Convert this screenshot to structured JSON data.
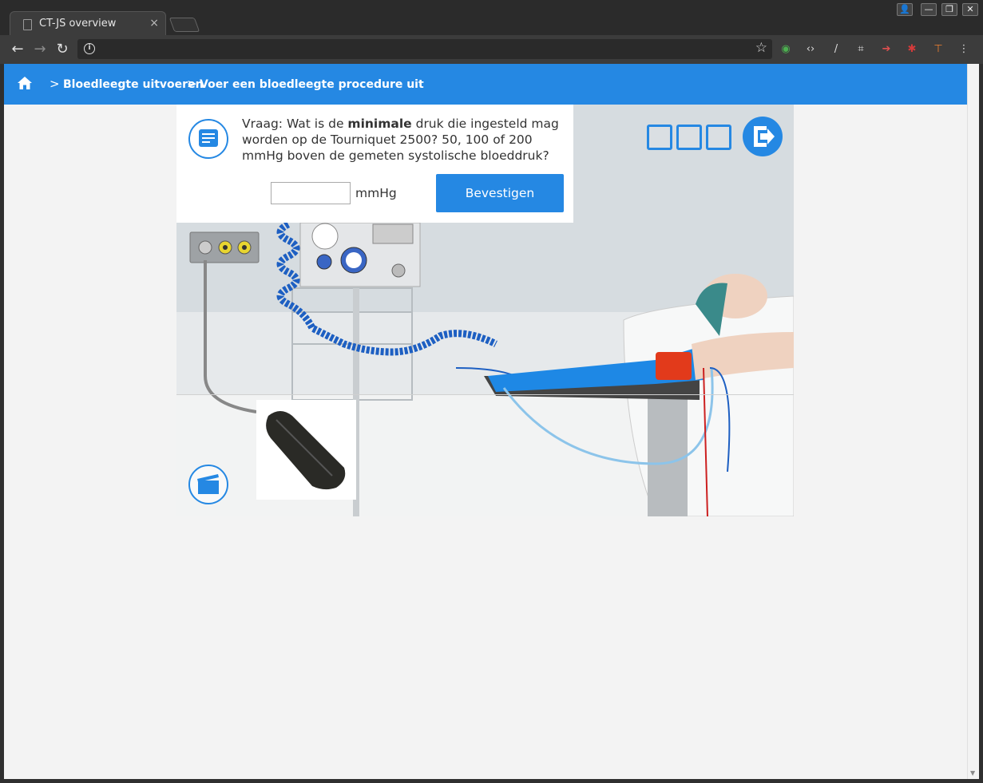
{
  "browser": {
    "tab_title": "CT-JS overview",
    "tab_close": "×",
    "window_buttons": [
      "👤",
      "—",
      "❐",
      "✕"
    ],
    "back": "←",
    "forward": "→",
    "reload": "↻",
    "info": "i",
    "star": "☆",
    "url": "",
    "extensions": [
      {
        "name": "search-ext-icon",
        "glyph": "◉",
        "color": "#4caf50"
      },
      {
        "name": "code-ext-icon",
        "glyph": "‹›",
        "color": "#dddddd"
      },
      {
        "name": "pen-ext-icon",
        "glyph": "/",
        "color": "#dddddd"
      },
      {
        "name": "crop-ext-icon",
        "glyph": "⌗",
        "color": "#dddddd"
      },
      {
        "name": "arrow-ext-icon",
        "glyph": "➔",
        "color": "#e05050"
      },
      {
        "name": "bug-ext-icon",
        "glyph": "✱",
        "color": "#d63b3b"
      },
      {
        "name": "tool-ext-icon",
        "glyph": "⊤",
        "color": "#f08030"
      },
      {
        "name": "menu-icon",
        "glyph": "⋮",
        "color": "#dddddd"
      }
    ]
  },
  "breadcrumb": {
    "items": [
      "Bloedleegte uitvoeren",
      "Voer een bloedleegte procedure uit"
    ],
    "separator": ">"
  },
  "question": {
    "prefix": "Vraag: Wat is de ",
    "emphasis": "minimale",
    "suffix": " druk die ingesteld mag worden op de Tourniquet 2500? 50, 100 of 200 mmHg boven de gemeten systolische bloeddruk?",
    "input_value": "",
    "unit": "mmHg",
    "confirm_label": "Bevestigen"
  },
  "progress": {
    "total_steps": 3,
    "completed_steps": 0
  },
  "colors": {
    "accent": "#2588e3",
    "page_bg": "#f3f3f3"
  }
}
